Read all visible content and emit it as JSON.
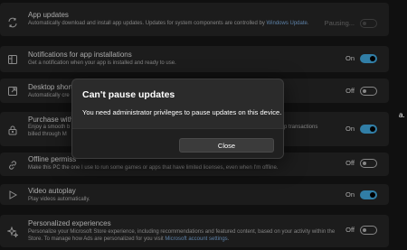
{
  "settings": [
    {
      "icon": "refresh-icon",
      "title": "App updates",
      "desc_parts": [
        {
          "text": "Automatically download and install app updates. Updates for system components are controlled by "
        },
        {
          "text": "Windows Update",
          "link": true
        },
        {
          "text": "."
        }
      ],
      "state": "Pausing...",
      "toggle": "disabled"
    },
    {
      "icon": "notification-icon",
      "title": "Notifications for app installations",
      "desc_parts": [
        {
          "text": "Get a notification when your app is installed and ready to use."
        }
      ],
      "state": "On",
      "toggle": "on"
    },
    {
      "icon": "external-link-icon",
      "title": "Desktop shortc",
      "desc_parts": [
        {
          "text": "Automatically cre"
        }
      ],
      "state": "Off",
      "toggle": "off"
    },
    {
      "icon": "lock-icon",
      "title": "Purchase witho",
      "desc_parts": [
        {
          "text": "Enjoy a smooth b"
        },
        {
          "text": "\nbilled through M"
        }
      ],
      "desc_right": "p transactions",
      "state": "On",
      "toggle": "on"
    },
    {
      "icon": "link-icon",
      "title": "Offline permiss",
      "desc_parts": [
        {
          "text": "Make this PC the one I use to run some games or apps that have limited licenses, even when I'm offline."
        }
      ],
      "state": "Off",
      "toggle": "off"
    },
    {
      "icon": "play-icon",
      "title": "Video autoplay",
      "desc_parts": [
        {
          "text": "Play videos automatically."
        }
      ],
      "state": "On",
      "toggle": "on"
    },
    {
      "icon": "sparkle-icon",
      "title": "Personalized experiences",
      "desc_parts": [
        {
          "text": "Personalize your Microsoft Store experience, including recommendations and featured content, based on your activity within the Store. To manage how Ads are personalized for you visit "
        },
        {
          "text": "Microsoft account settings",
          "link": true
        },
        {
          "text": "."
        }
      ],
      "state": "Off",
      "toggle": "off"
    }
  ],
  "edge_text": "a.",
  "dialog": {
    "title": "Can't pause updates",
    "body": "You need administrator privileges to pause updates on this device.",
    "close_label": "Close"
  }
}
